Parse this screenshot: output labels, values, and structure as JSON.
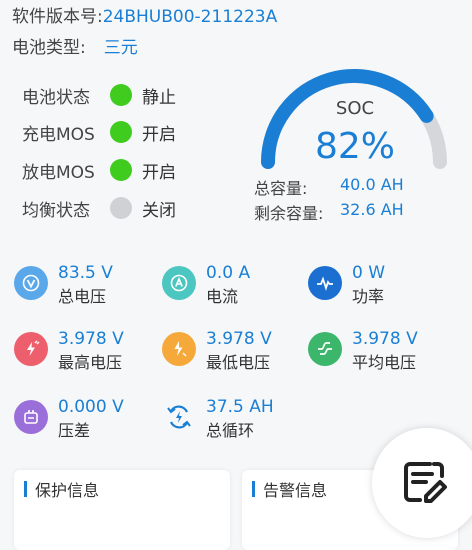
{
  "header": {
    "firmware_label": "软件版本号:",
    "firmware_value": "24BHUB00-211223A",
    "battery_type_label": "电池类型:",
    "battery_type_value": "三元"
  },
  "status": [
    {
      "label": "电池状态",
      "value": "静止",
      "on": true
    },
    {
      "label": "充电MOS",
      "value": "开启",
      "on": true
    },
    {
      "label": "放电MOS",
      "value": "开启",
      "on": true
    },
    {
      "label": "均衡状态",
      "value": "关闭",
      "on": false
    }
  ],
  "soc": {
    "title": "SOC",
    "value_text": "82%",
    "fraction": 0.82,
    "total_label": "总容量:",
    "total_value": "40.0 AH",
    "remain_label": "剩余容量:",
    "remain_value": "32.6 AH",
    "arc_color": "#1a7fd4",
    "track_color": "#d5d7da"
  },
  "metrics": [
    {
      "value": "83.5 V",
      "label": "总电压",
      "icon": "total-voltage-icon",
      "color": "#5aa8ea"
    },
    {
      "value": "0.0 A",
      "label": "电流",
      "icon": "current-icon",
      "color": "#4cc6c0"
    },
    {
      "value": "0 W",
      "label": "功率",
      "icon": "power-icon",
      "color": "#1a6fd0"
    },
    {
      "value": "3.978 V",
      "label": "最高电压",
      "icon": "max-voltage-icon",
      "color": "#ee5f6e"
    },
    {
      "value": "3.978 V",
      "label": "最低电压",
      "icon": "min-voltage-icon",
      "color": "#f5a93a"
    },
    {
      "value": "3.978 V",
      "label": "平均电压",
      "icon": "avg-voltage-icon",
      "color": "#3bb66a"
    },
    {
      "value": "0.000 V",
      "label": "压差",
      "icon": "voltage-diff-icon",
      "color": "#9b6fd9"
    },
    {
      "value": "37.5 AH",
      "label": "总循环",
      "icon": "cycle-icon",
      "color": "#1a7fd4"
    }
  ],
  "cards": {
    "protection_title": "保护信息",
    "alarm_title": "告警信息"
  },
  "fab": {
    "icon": "edit-note-icon"
  }
}
